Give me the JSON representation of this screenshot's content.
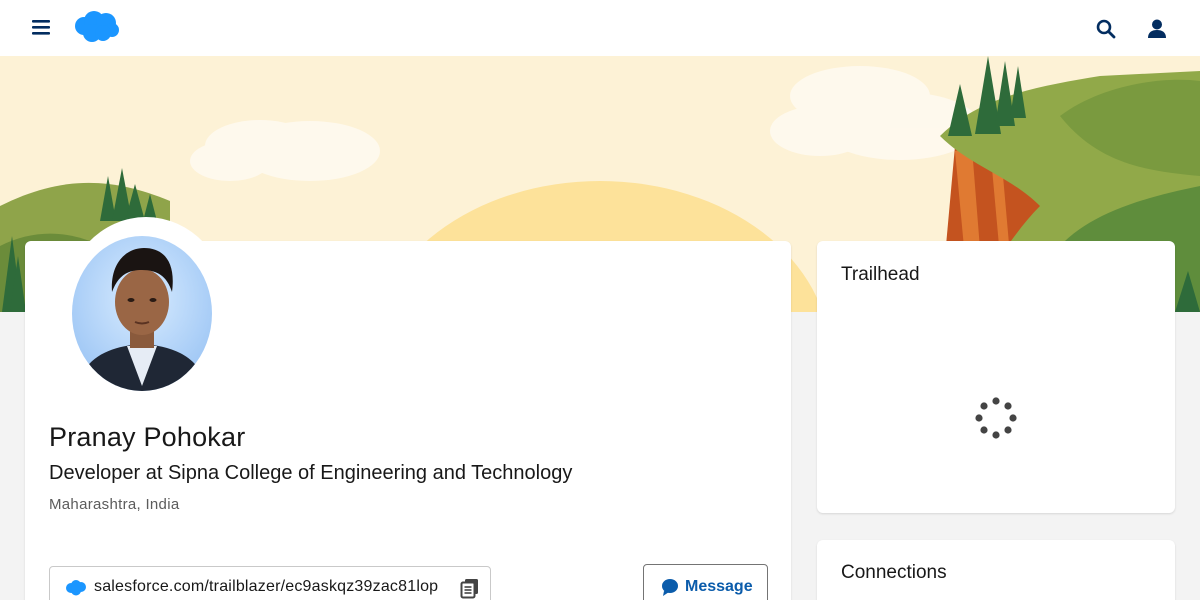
{
  "header": {
    "menu_icon": "hamburger-menu-icon",
    "logo": "salesforce-cloud-logo",
    "search_icon": "search-icon",
    "profile_icon": "user-profile-icon",
    "accent_color": "#032d60"
  },
  "banner": {
    "description_icons": [
      "sun",
      "clouds",
      "hills",
      "pine-trees",
      "canyon-cliff"
    ]
  },
  "profile": {
    "name": "Pranay Pohokar",
    "title": "Developer at Sipna College of Engineering and Technology",
    "location": "Maharashtra, India",
    "profile_url": "salesforce.com/trailblazer/ec9askqz39zac81lop",
    "copy_icon": "copy-icon",
    "message_label": "Message",
    "message_color": "#0b5cab"
  },
  "trailhead": {
    "title": "Trailhead",
    "loading_icon": "loading-spinner-icon"
  },
  "connections": {
    "title": "Connections"
  }
}
